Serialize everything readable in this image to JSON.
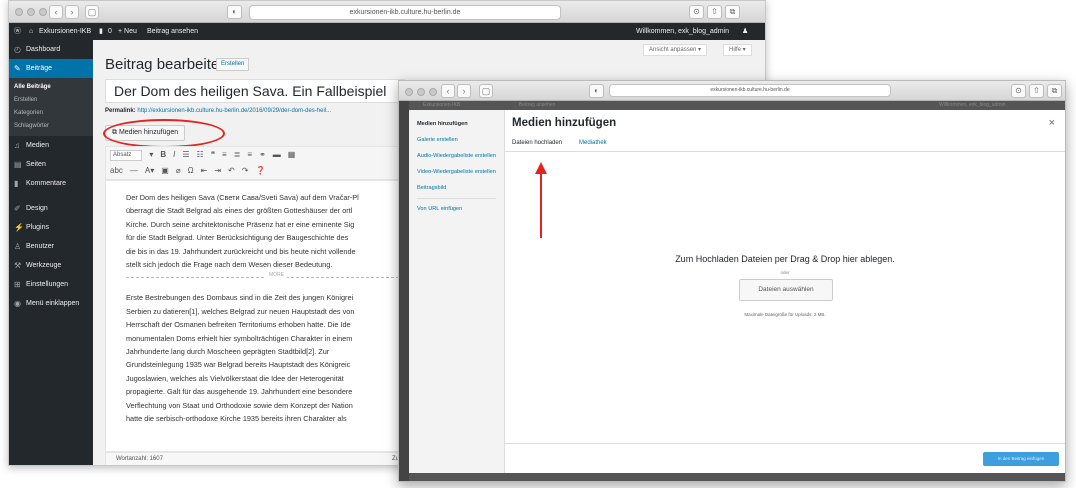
{
  "back_window": {
    "url": "exkursionen-ikb.culture.hu-berlin.de",
    "admin_bar": {
      "site_name": "Exkursionen-IKB",
      "comments_count": "0",
      "new_label": "+ Neu",
      "view_post_label": "Beitrag ansehen",
      "greeting": "Willkommen, exk_blog_admin"
    },
    "sidebar": {
      "items": [
        {
          "label": "Dashboard",
          "icon": "dashboard-icon"
        },
        {
          "label": "Beiträge",
          "icon": "pin-icon"
        },
        {
          "label": "Medien",
          "icon": "media-icon"
        },
        {
          "label": "Seiten",
          "icon": "pages-icon"
        },
        {
          "label": "Kommentare",
          "icon": "comments-icon"
        },
        {
          "label": "Design",
          "icon": "brush-icon"
        },
        {
          "label": "Plugins",
          "icon": "plugin-icon"
        },
        {
          "label": "Benutzer",
          "icon": "users-icon"
        },
        {
          "label": "Werkzeuge",
          "icon": "tools-icon"
        },
        {
          "label": "Einstellungen",
          "icon": "settings-icon"
        },
        {
          "label": "Menü einklappen",
          "icon": "collapse-icon"
        }
      ],
      "submenu": [
        "Alle Beiträge",
        "Erstellen",
        "Kategorien",
        "Schlagwörter"
      ]
    },
    "screen_options": "Ansicht anpassen ▾",
    "help": "Hilfe ▾",
    "page_title": "Beitrag bearbeiten",
    "page_title_action": "Erstellen",
    "post_title": "Der Dom des heiligen Sava. Ein Fallbeispiel",
    "permalink_label": "Permalink:",
    "permalink_url": "http://exkursionen-ikb.culture.hu-berlin.de/2016/09/29/der-dom-des-heil...",
    "add_media_button": "Medien hinzufügen",
    "format_select": "Absatz",
    "editor_paragraphs": [
      "Der Dom des heiligen Sava (Свети Сава/Sveti Sava) auf dem Vračar-Pl",
      "überragt die Stadt Belgrad als eines der größten Gotteshäuser der ortl",
      "Kirche. Durch seine architektonische Präsenz hat er eine eminente Sig",
      "für die Stadt Belgrad. Unter Berücksichtigung der Baugeschichte des",
      "die bis in das 19. Jahrhundert zurückreicht und bis heute nicht vollende",
      "stellt sich jedoch die Frage nach dem Wesen dieser Bedeutung."
    ],
    "more_label": "MORE",
    "editor_paragraphs_2": [
      "Erste Bestrebungen des Dombaus sind in die Zeit des jungen Königrei",
      "Serbien zu datieren[1], welches Belgrad zur neuen Hauptstadt des von",
      "Herrschaft der Osmanen befreiten Territoriums erhoben hatte. Die Ide",
      "monumentalen Doms erhielt hier symbolträchtigen Charakter in einem",
      "Jahrhunderte lang durch Moscheen geprägten Stadtbild[2]. Zur",
      "Grundsteinlegung 1935 war Belgrad bereits Hauptstadt des Königreic",
      "Jugoslawien, welches als Vielvölkerstaat die Idee der Heterogenität",
      "propagierte. Galt für das ausgehende 19. Jahrhundert eine besondere",
      "Verflechtung von Staat und Orthodoxie sowie dem Konzept der Nation",
      "hatte die serbisch-orthodoxe Kirche 1935 bereits ihren Charakter als"
    ],
    "word_count": "Wortanzahl: 1607",
    "word_count_right": "Zu"
  },
  "front_window": {
    "url": "exkursionen-ikb.culture.hu-berlin.de",
    "shade_site_name": "Exkursionen-IKB",
    "shade_view_post": "Beitrag ansehen",
    "shade_greeting": "Willkommen, exk_blog_admin",
    "media_menu": {
      "items": [
        "Medien hinzufügen",
        "Galerie erstellen",
        "Audio-Wiedergabeliste erstellen",
        "Video-Wiedergabeliste erstellen",
        "Beitragsbild",
        "Von URL einfügen"
      ]
    },
    "modal_title": "Medien hinzufügen",
    "close": "×",
    "tabs": [
      "Dateien hochladen",
      "Mediathek"
    ],
    "drop_text": "Zum Hochladen Dateien per Drag & Drop hier ablegen.",
    "or_text": "oder",
    "select_files_button": "Dateien auswählen",
    "max_size": "Maximale Dateigröße für Uploads: 2 MB.",
    "insert_button": "In den Beitrag einfügen"
  },
  "colors": {
    "admin_dark": "#23282d",
    "accent_blue": "#0073aa",
    "annotation_red": "#e3231f"
  }
}
